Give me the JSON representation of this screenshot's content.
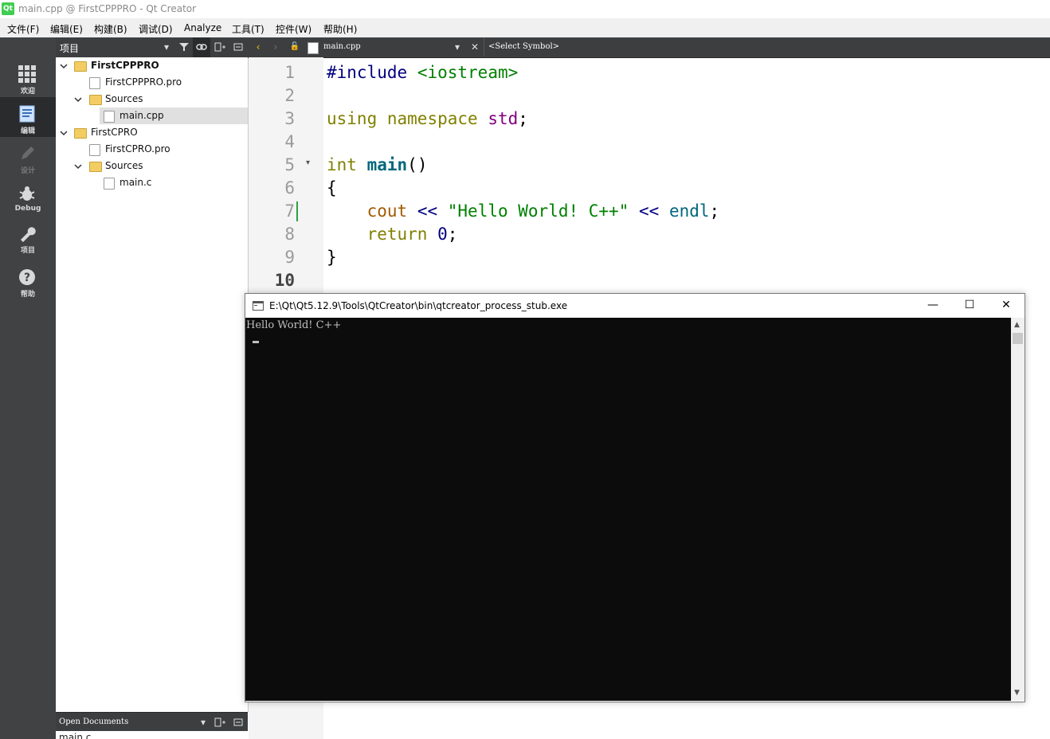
{
  "window": {
    "app_icon": "Qt",
    "title": "main.cpp @ FirstCPPPRO - Qt Creator"
  },
  "menu": [
    "文件(F)",
    "编辑(E)",
    "构建(B)",
    "调试(D)",
    "Analyze",
    "工具(T)",
    "控件(W)",
    "帮助(H)"
  ],
  "modes": [
    {
      "label": "欢迎",
      "icon": "grid-icon"
    },
    {
      "label": "编辑",
      "icon": "edit-doc-icon"
    },
    {
      "label": "设计",
      "icon": "pencil-icon"
    },
    {
      "label": "Debug",
      "icon": "bug-icon"
    },
    {
      "label": "项目",
      "icon": "wrench-icon"
    },
    {
      "label": "帮助",
      "icon": "help-icon"
    }
  ],
  "project_panel": {
    "title": "项目"
  },
  "tree": [
    {
      "label": "FirstCPPPRO",
      "bold": true
    },
    {
      "label": "FirstCPPPRO.pro"
    },
    {
      "label": "Sources"
    },
    {
      "label": "main.cpp",
      "selected": true
    },
    {
      "label": "FirstCPRO"
    },
    {
      "label": "FirstCPRO.pro"
    },
    {
      "label": "Sources"
    },
    {
      "label": "main.c"
    }
  ],
  "open_documents": {
    "title": "Open Documents",
    "first": "main.c"
  },
  "editor": {
    "file_tab": "main.cpp",
    "symbol": "<Select Symbol>",
    "line_numbers": [
      "1",
      "2",
      "3",
      "4",
      "5",
      "6",
      "7",
      "8",
      "9",
      "10"
    ],
    "current_line": "10"
  },
  "code": {
    "l1": {
      "directive": "#include",
      "header": "<iostream>"
    },
    "l3": {
      "using": "using",
      "namespace": "namespace",
      "std": "std",
      "semi": ";"
    },
    "l5": {
      "int": "int",
      "main": "main",
      "parens": "()"
    },
    "l6": "{",
    "l7": {
      "cout": "cout",
      "op1": "<<",
      "str": "\"Hello World! C++\"",
      "op2": "<<",
      "endl": "endl",
      "semi": ";"
    },
    "l8": {
      "ret": "return",
      "zero": "0",
      "semi": ";"
    },
    "l9": "}"
  },
  "console": {
    "title": "E:\\Qt\\Qt5.12.9\\Tools\\QtCreator\\bin\\qtcreator_process_stub.exe",
    "output": "Hello World! C++",
    "btn_min": "—",
    "btn_max": "☐",
    "btn_close": "✕"
  }
}
